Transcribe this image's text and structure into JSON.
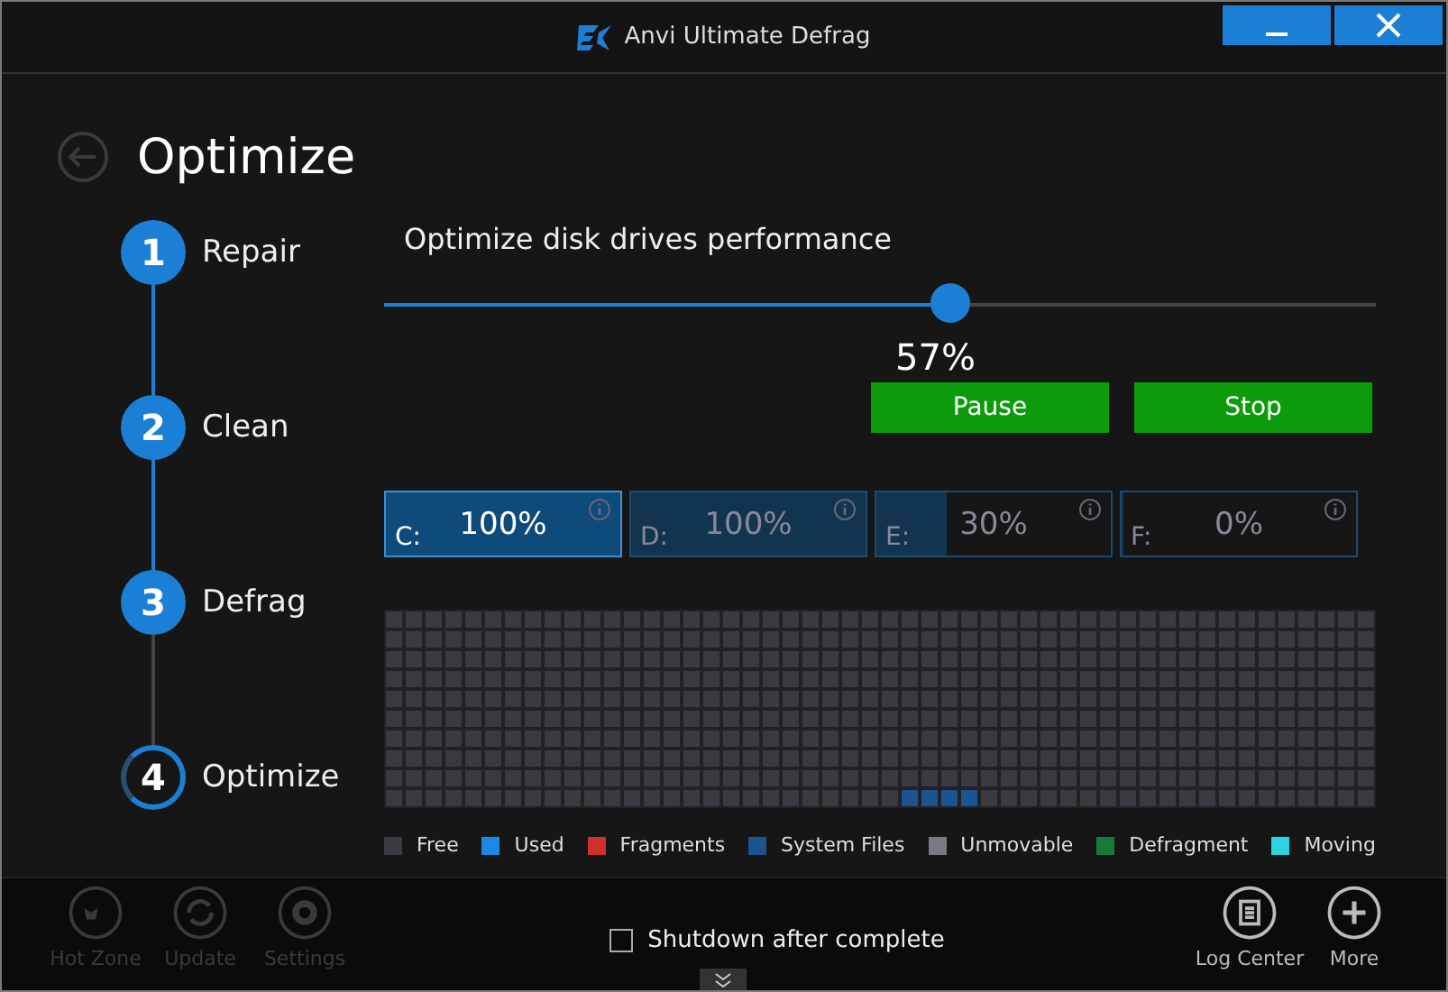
{
  "window": {
    "title": "Anvi Ultimate Defrag"
  },
  "page": {
    "title": "Optimize"
  },
  "steps": [
    {
      "number": "1",
      "label": "Repair",
      "done": true
    },
    {
      "number": "2",
      "label": "Clean",
      "done": true
    },
    {
      "number": "3",
      "label": "Defrag",
      "done": true
    },
    {
      "number": "4",
      "label": "Optimize",
      "done": false
    }
  ],
  "task": {
    "heading": "Optimize disk drives performance",
    "level": 0.57,
    "reading": "57%"
  },
  "buttons": [
    {
      "label": "Pause"
    },
    {
      "label": "Stop"
    }
  ],
  "drives": [
    {
      "letter": "C:",
      "percent": "100%",
      "level": 1,
      "selected": true
    },
    {
      "letter": "D:",
      "percent": "100%",
      "level": 1,
      "selected": false
    },
    {
      "letter": "E:",
      "percent": "30%",
      "level": 0.3,
      "selected": false
    },
    {
      "letter": "F:",
      "percent": "0%",
      "level": 0,
      "selected": false
    }
  ],
  "legend": [
    {
      "label": "Free",
      "color": "#3a3a40"
    },
    {
      "label": "Used",
      "color": "#1e88e5"
    },
    {
      "label": "Fragments",
      "color": "#d32f2f"
    },
    {
      "label": "System Files",
      "color": "#1a5590"
    },
    {
      "label": "Unmovable",
      "color": "#7a7a82"
    },
    {
      "label": "Defragment",
      "color": "#177a3a"
    },
    {
      "label": "Moving",
      "color": "#2ad4e0"
    }
  ],
  "footer": {
    "left": [
      {
        "kind": "hotzone",
        "label": "Hot Zone",
        "disabled": true
      },
      {
        "kind": "update",
        "label": "Update",
        "disabled": true
      },
      {
        "kind": "settings",
        "label": "Settings",
        "disabled": true
      }
    ],
    "shutdown": {
      "label": "Shutdown after complete",
      "checked": false
    },
    "right": [
      {
        "kind": "log",
        "label": "Log Center",
        "disabled": false
      },
      {
        "kind": "more",
        "label": "More",
        "disabled": false
      }
    ]
  }
}
